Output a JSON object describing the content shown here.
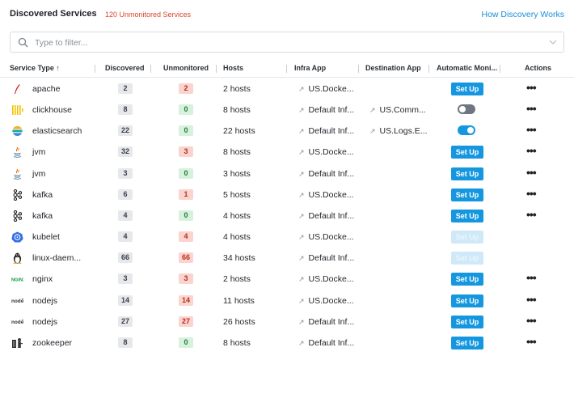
{
  "header": {
    "title": "Discovered Services",
    "unmonitored_link": "120 Unmonitored Services",
    "how_link": "How Discovery Works"
  },
  "filter": {
    "placeholder": "Type to filter..."
  },
  "columns": {
    "service_type": "Service Type ↑",
    "discovered": "Discovered",
    "unmonitored": "Unmonitored",
    "hosts": "Hosts",
    "infra_app": "Infra App",
    "destination_app": "Destination App",
    "automatic_monitoring": "Automatic Moni...",
    "actions": "Actions"
  },
  "colors": {
    "accent": "#1597e0",
    "danger": "#d9452a",
    "link": "#1a8fd6"
  },
  "rows": [
    {
      "name": "apache",
      "icon": "apache-feather-icon",
      "discovered": "2",
      "unmonitored": "2",
      "hosts": "2 hosts",
      "infra": "US.Docke...",
      "dest": "",
      "auto": "button",
      "button_label": "Set Up",
      "actions": "•••"
    },
    {
      "name": "clickhouse",
      "icon": "clickhouse-icon",
      "discovered": "8",
      "unmonitored": "0",
      "hosts": "8 hosts",
      "infra": "Default Inf...",
      "dest": "US.Comm...",
      "auto": "toggle-off",
      "button_label": "",
      "actions": "•••"
    },
    {
      "name": "elasticsearch",
      "icon": "elasticsearch-icon",
      "discovered": "22",
      "unmonitored": "0",
      "hosts": "22 hosts",
      "infra": "Default Inf...",
      "dest": "US.Logs.E...",
      "auto": "toggle-on",
      "button_label": "",
      "actions": "•••"
    },
    {
      "name": "jvm",
      "icon": "java-icon",
      "discovered": "32",
      "unmonitored": "3",
      "hosts": "8 hosts",
      "infra": "US.Docke...",
      "dest": "",
      "auto": "button",
      "button_label": "Set Up",
      "actions": "•••"
    },
    {
      "name": "jvm",
      "icon": "java-icon",
      "discovered": "3",
      "unmonitored": "0",
      "hosts": "3 hosts",
      "infra": "Default Inf...",
      "dest": "",
      "auto": "button",
      "button_label": "Set Up",
      "actions": "•••"
    },
    {
      "name": "kafka",
      "icon": "kafka-icon",
      "discovered": "6",
      "unmonitored": "1",
      "hosts": "5 hosts",
      "infra": "US.Docke...",
      "dest": "",
      "auto": "button",
      "button_label": "Set Up",
      "actions": "•••"
    },
    {
      "name": "kafka",
      "icon": "kafka-icon",
      "discovered": "4",
      "unmonitored": "0",
      "hosts": "4 hosts",
      "infra": "Default Inf...",
      "dest": "",
      "auto": "button",
      "button_label": "Set Up",
      "actions": "•••"
    },
    {
      "name": "kubelet",
      "icon": "kubernetes-icon",
      "discovered": "4",
      "unmonitored": "4",
      "hosts": "4 hosts",
      "infra": "US.Docke...",
      "dest": "",
      "auto": "button-disabled",
      "button_label": "Set Up",
      "actions": ""
    },
    {
      "name": "linux-daem...",
      "icon": "linux-penguin-icon",
      "discovered": "66",
      "unmonitored": "66",
      "hosts": "34 hosts",
      "infra": "Default Inf...",
      "dest": "",
      "auto": "button-disabled",
      "button_label": "Set Up",
      "actions": ""
    },
    {
      "name": "nginx",
      "icon": "nginx-icon",
      "discovered": "3",
      "unmonitored": "3",
      "hosts": "2 hosts",
      "infra": "US.Docke...",
      "dest": "",
      "auto": "button",
      "button_label": "Set Up",
      "actions": "•••"
    },
    {
      "name": "nodejs",
      "icon": "nodejs-icon",
      "discovered": "14",
      "unmonitored": "14",
      "hosts": "11 hosts",
      "infra": "US.Docke...",
      "dest": "",
      "auto": "button",
      "button_label": "Set Up",
      "actions": "•••"
    },
    {
      "name": "nodejs",
      "icon": "nodejs-icon",
      "discovered": "27",
      "unmonitored": "27",
      "hosts": "26 hosts",
      "infra": "Default Inf...",
      "dest": "",
      "auto": "button",
      "button_label": "Set Up",
      "actions": "•••"
    },
    {
      "name": "zookeeper",
      "icon": "zookeeper-icon",
      "discovered": "8",
      "unmonitored": "0",
      "hosts": "8 hosts",
      "infra": "Default Inf...",
      "dest": "",
      "auto": "button",
      "button_label": "Set Up",
      "actions": "•••"
    }
  ]
}
